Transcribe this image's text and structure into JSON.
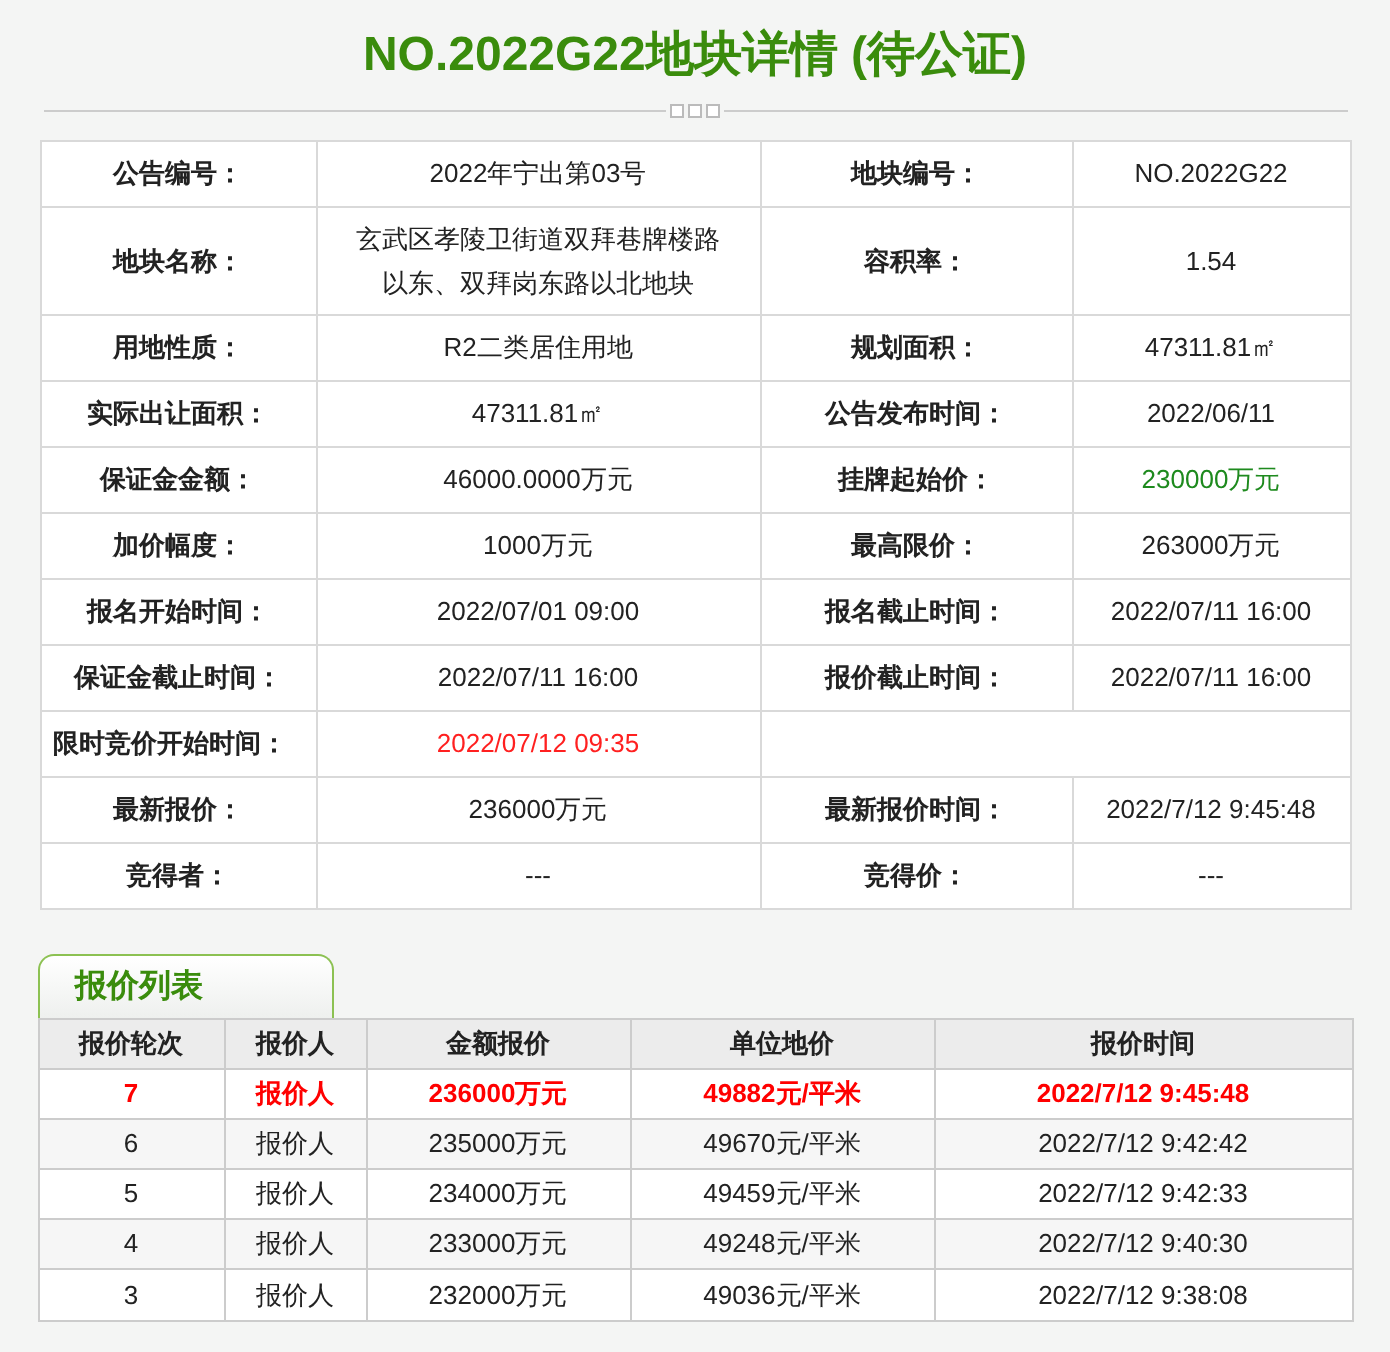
{
  "title": "NO.2022G22地块详情 (待公证)",
  "details": [
    {
      "kind": "pair",
      "cells": [
        {
          "label": "公告编号：",
          "value": "2022年宁出第03号"
        },
        {
          "label": "地块编号：",
          "value": "NO.2022G22"
        }
      ]
    },
    {
      "kind": "pair",
      "cells": [
        {
          "label": "地块名称：",
          "value": "玄武区孝陵卫街道双拜巷牌楼路以东、双拜岗东路以北地块"
        },
        {
          "label": "容积率：",
          "value": "1.54"
        }
      ]
    },
    {
      "kind": "pair",
      "cells": [
        {
          "label": "用地性质：",
          "value": "R2二类居住用地"
        },
        {
          "label": "规划面积：",
          "value": "47311.81㎡"
        }
      ]
    },
    {
      "kind": "pair",
      "cells": [
        {
          "label": "实际出让面积：",
          "value": "47311.81㎡"
        },
        {
          "label": "公告发布时间：",
          "value": "2022/06/11"
        }
      ]
    },
    {
      "kind": "pair",
      "cells": [
        {
          "label": "保证金金额：",
          "value": "46000.0000万元"
        },
        {
          "label": "挂牌起始价：",
          "value": "230000万元",
          "color": "#1e8a1e"
        }
      ]
    },
    {
      "kind": "pair",
      "cells": [
        {
          "label": "加价幅度：",
          "value": "1000万元"
        },
        {
          "label": "最高限价：",
          "value": "263000万元"
        }
      ]
    },
    {
      "kind": "pair",
      "cells": [
        {
          "label": "报名开始时间：",
          "value": "2022/07/01 09:00"
        },
        {
          "label": "报名截止时间：",
          "value": "2022/07/11 16:00"
        }
      ]
    },
    {
      "kind": "pair",
      "cells": [
        {
          "label": "保证金截止时间：",
          "value": "2022/07/11 16:00"
        },
        {
          "label": "报价截止时间：",
          "value": "2022/07/11 16:00"
        }
      ]
    },
    {
      "kind": "single",
      "cells": [
        {
          "label": "限时竞价开始时间：",
          "value": "2022/07/12 09:35",
          "color": "#ff2020"
        }
      ]
    },
    {
      "kind": "pair",
      "cells": [
        {
          "label": "最新报价：",
          "value": "236000万元"
        },
        {
          "label": "最新报价时间：",
          "value": "2022/7/12 9:45:48"
        }
      ]
    },
    {
      "kind": "pair",
      "cells": [
        {
          "label": "竞得者：",
          "value": "---"
        },
        {
          "label": "竞得价：",
          "value": "---"
        }
      ]
    }
  ],
  "bids": {
    "tab": "报价列表",
    "columns": [
      "报价轮次",
      "报价人",
      "金额报价",
      "单位地价",
      "报价时间"
    ],
    "rows": [
      {
        "latest": true,
        "cells": [
          "7",
          "报价人",
          "236000万元",
          "49882元/平米",
          "2022/7/12 9:45:48"
        ]
      },
      {
        "latest": false,
        "cells": [
          "6",
          "报价人",
          "235000万元",
          "49670元/平米",
          "2022/7/12 9:42:42"
        ]
      },
      {
        "latest": false,
        "cells": [
          "5",
          "报价人",
          "234000万元",
          "49459元/平米",
          "2022/7/12 9:42:33"
        ]
      },
      {
        "latest": false,
        "cells": [
          "4",
          "报价人",
          "233000万元",
          "49248元/平米",
          "2022/7/12 9:40:30"
        ]
      },
      {
        "latest": false,
        "cells": [
          "3",
          "报价人",
          "232000万元",
          "49036元/平米",
          "2022/7/12 9:38:08"
        ]
      }
    ]
  }
}
